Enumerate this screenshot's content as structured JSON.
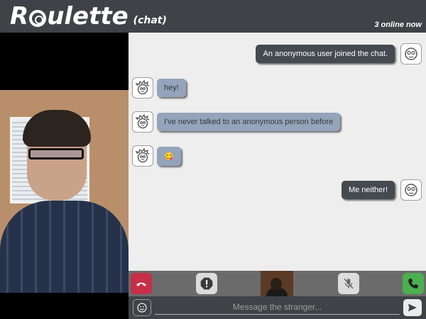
{
  "header": {
    "logo_first": "R",
    "logo_rest": "ulette",
    "logo_sub": "(chat)",
    "online_status": "3 online now"
  },
  "chat": {
    "messages": [
      {
        "sender": "me",
        "text": "An anonymous user joined the chat."
      },
      {
        "sender": "stranger",
        "text": "hey!"
      },
      {
        "sender": "stranger",
        "text": "I've never talked to an anonymous person before"
      },
      {
        "sender": "stranger",
        "text": "😋"
      },
      {
        "sender": "me",
        "text": "Me neither!"
      }
    ]
  },
  "controls": {
    "buttons": [
      {
        "name": "end-call-button",
        "icon": "phone-hangup-icon",
        "color": "#c62f47"
      },
      {
        "name": "report-button",
        "icon": "exclamation-icon",
        "color": "#dcdcdc"
      },
      {
        "name": "mute-mic-button",
        "icon": "mic-off-icon",
        "color": "#dcdcdc"
      },
      {
        "name": "call-button",
        "icon": "phone-icon",
        "color": "#4caf50"
      }
    ]
  },
  "input": {
    "placeholder": "Message the stranger...",
    "value": ""
  },
  "colors": {
    "header_bg": "#3f4347",
    "my_bubble": "#444a50",
    "stranger_bubble": "#93a4bb",
    "chat_bg": "#eeeeee"
  }
}
